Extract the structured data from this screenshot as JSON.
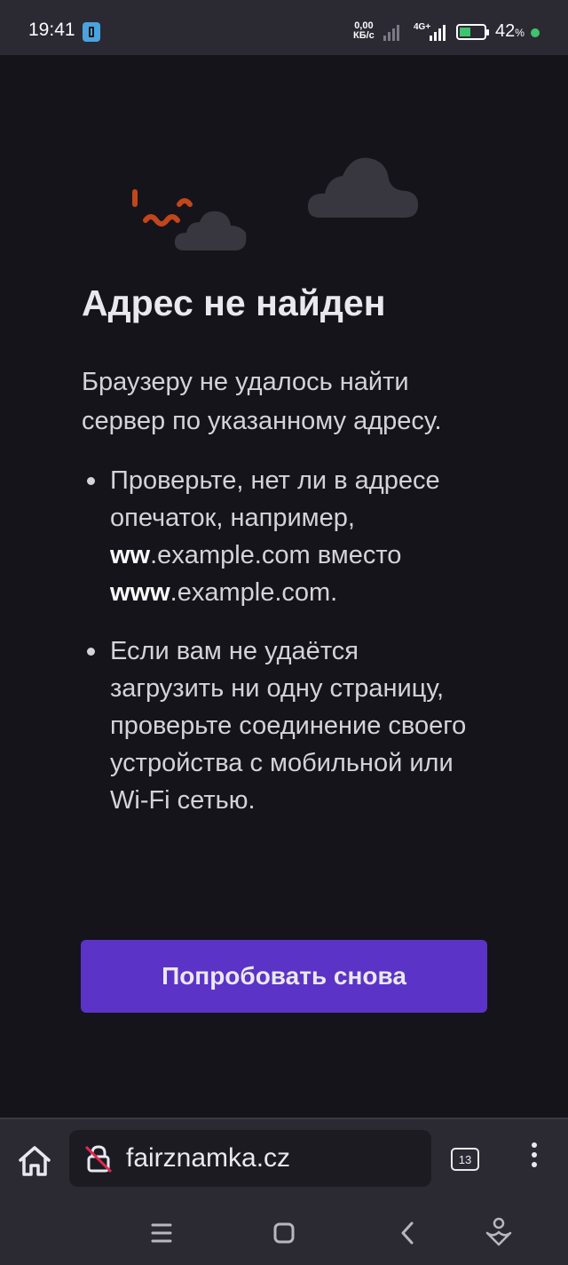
{
  "status_bar": {
    "time": "19:41",
    "speed_value": "0,00",
    "speed_unit": "КБ/с",
    "network": "4G+",
    "battery_percent": "42",
    "battery_unit": "%",
    "icons": [
      "sim-icon",
      "signal-icon",
      "battery-charging-icon"
    ]
  },
  "error_page": {
    "title": "Адрес не найден",
    "description": "Браузеру не удалось найти сервер по указанному адресу.",
    "tips": [
      {
        "part1": "Проверьте, нет ли в адресе опечаток, например, ",
        "bold1": "ww",
        "part2": ".example.com вместо ",
        "bold2": "www",
        "part3": ".example.com."
      },
      {
        "text": "Если вам не удаётся загрузить ни одну страницу, проверьте соединение своего устройства с мобильной или Wi-Fi сетью."
      }
    ],
    "retry_label": "Попробовать снова"
  },
  "toolbar": {
    "url": "fairznamka.cz",
    "tab_count": "13",
    "icons": [
      "home-icon",
      "insecure-lock-icon",
      "tabs-icon",
      "menu-icon"
    ]
  },
  "nav_bar": {
    "icons": [
      "recents-icon",
      "home-square-icon",
      "back-icon",
      "assistant-icon"
    ]
  },
  "colors": {
    "background": "#15141a",
    "bar": "#2b2a33",
    "accent": "#5b33c7",
    "illustration_orange": "#c2461b",
    "battery_green": "#3ec46d"
  }
}
